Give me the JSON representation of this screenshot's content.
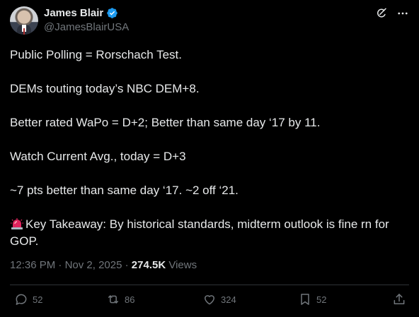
{
  "author": {
    "display_name": "James Blair",
    "handle": "@JamesBlairUSA",
    "verified": true
  },
  "header_icons": [
    "grok-icon",
    "more-icon"
  ],
  "tweet": {
    "paragraphs": [
      "Public Polling = Rorschach Test.",
      "DEMs touting today’s NBC DEM+8.",
      "Better rated WaPo = D+2; Better than same day ‘17 by 11.",
      "Watch Current Avg., today = D+3",
      "~7 pts better than same day ‘17. ~2 off ‘21."
    ],
    "takeaway_line1": "Key Takeaway: By historical standards, midterm outlook is fine rn for",
    "takeaway_line2": "GOP.",
    "takeaway_icon": "siren-icon"
  },
  "meta": {
    "time": "12:36 PM",
    "dot1": " · ",
    "date": "Nov 2, 2025",
    "dot2": " · ",
    "views_count": "274.5K",
    "views_label": " Views"
  },
  "actions": {
    "replies": "52",
    "reposts": "86",
    "likes": "324",
    "bookmarks": "52"
  },
  "colors": {
    "background": "#000000",
    "text": "#e7e9ea",
    "muted": "#71767b",
    "verified": "#1d9bf0",
    "divider": "#2f3336"
  }
}
